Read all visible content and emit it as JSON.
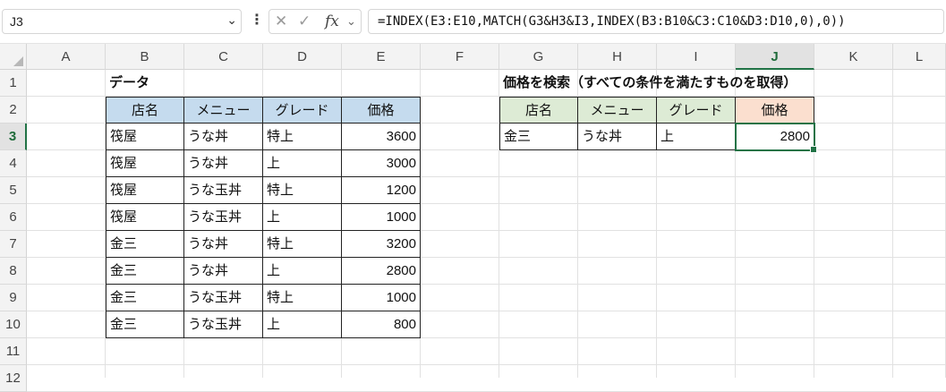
{
  "formula_bar": {
    "name_box": "J3",
    "cancel_icon": "cancel-icon",
    "enter_icon": "enter-icon",
    "fx_label": "fx",
    "formula": "=INDEX(E3:E10,MATCH(G3&H3&I3,INDEX(B3:B10&C3:C10&D3:D10,0),0))"
  },
  "columns": [
    "A",
    "B",
    "C",
    "D",
    "E",
    "F",
    "G",
    "H",
    "I",
    "J",
    "K",
    "L"
  ],
  "rows": [
    "1",
    "2",
    "3",
    "4",
    "5",
    "6",
    "7",
    "8",
    "9",
    "10",
    "11",
    "12"
  ],
  "selected_cell": {
    "column": "J",
    "row": "3"
  },
  "data_table": {
    "title": "データ",
    "headers": [
      "店名",
      "メニュー",
      "グレード",
      "価格"
    ],
    "rows": [
      [
        "筏屋",
        "うな丼",
        "特上",
        "3600"
      ],
      [
        "筏屋",
        "うな丼",
        "上",
        "3000"
      ],
      [
        "筏屋",
        "うな玉丼",
        "特上",
        "1200"
      ],
      [
        "筏屋",
        "うな玉丼",
        "上",
        "1000"
      ],
      [
        "金三",
        "うな丼",
        "特上",
        "3200"
      ],
      [
        "金三",
        "うな丼",
        "上",
        "2800"
      ],
      [
        "金三",
        "うな玉丼",
        "特上",
        "1000"
      ],
      [
        "金三",
        "うな玉丼",
        "上",
        "800"
      ]
    ]
  },
  "lookup": {
    "title": "価格を検索（すべての条件を満たすものを取得）",
    "headers": [
      "店名",
      "メニュー",
      "グレード",
      "価格"
    ],
    "values": [
      "金三",
      "うな丼",
      "上",
      "2800"
    ]
  },
  "colors": {
    "selection": "#217346",
    "header_blue": "#c5dbee",
    "header_green": "#ddebd5",
    "header_orange": "#fbdfcf"
  }
}
